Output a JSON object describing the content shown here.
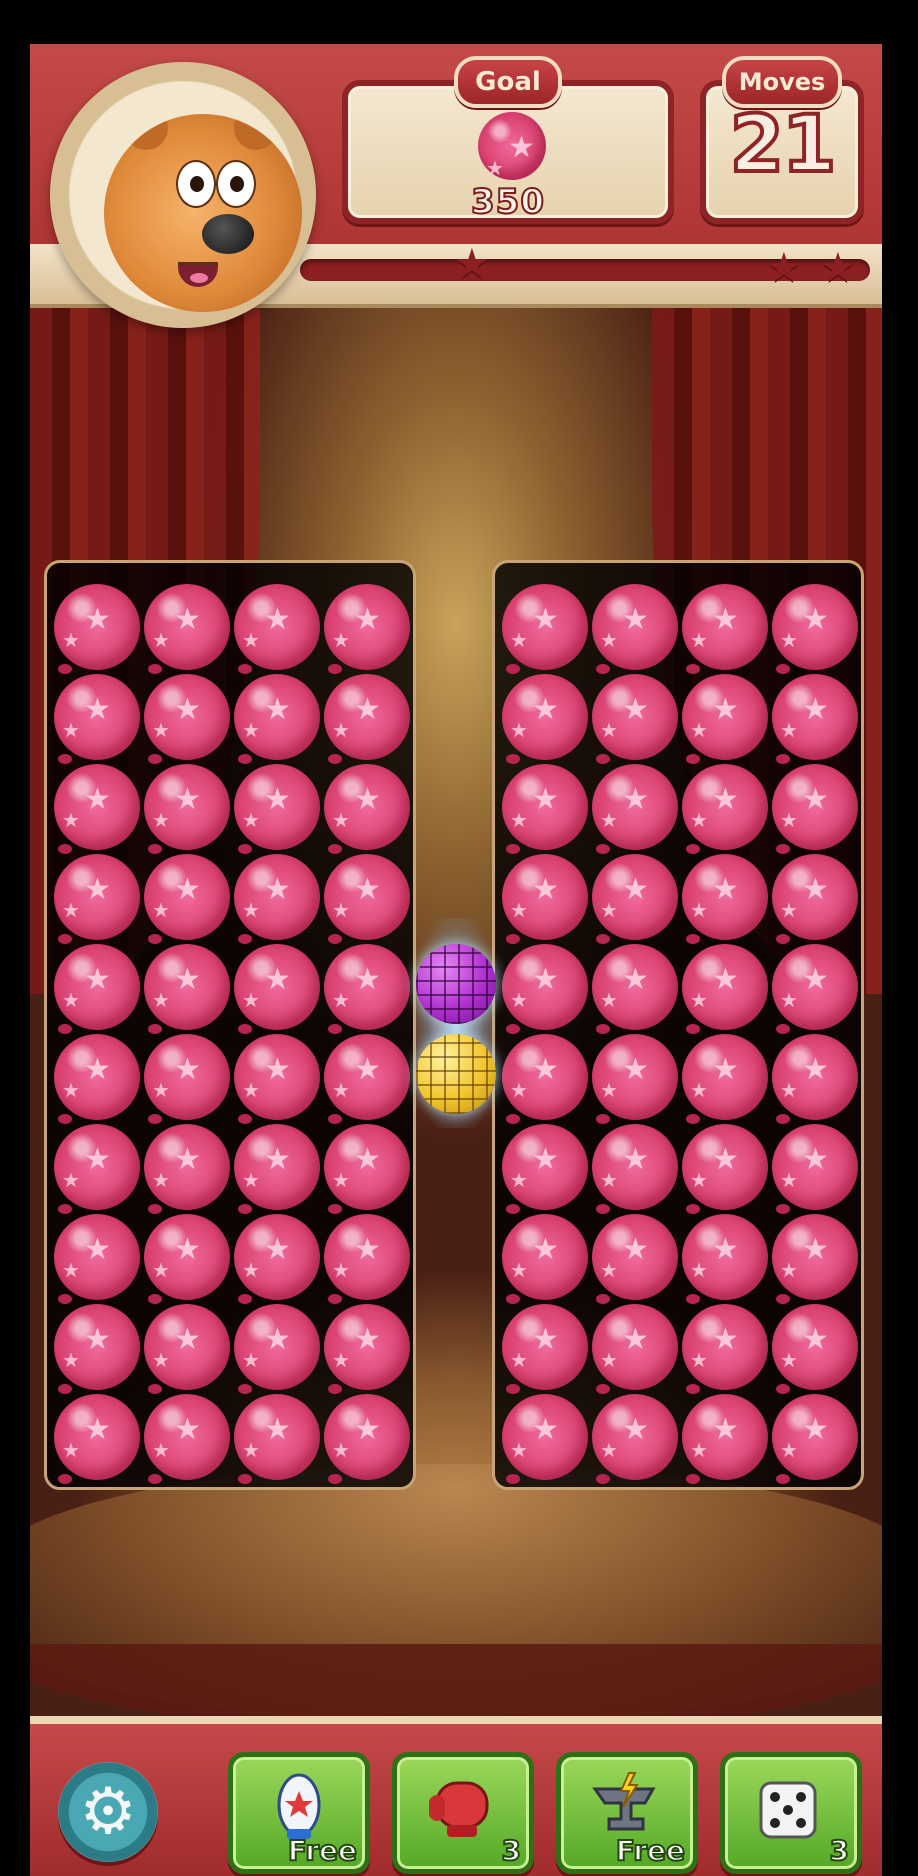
{
  "hud": {
    "goal_label": "Goal",
    "goal_count": "350",
    "goal_item": "pink-star-balloon",
    "moves_label": "Moves",
    "moves_value": "21",
    "progress": 0.0,
    "stars_total": 3
  },
  "board": {
    "left_grid": {
      "rows": 10,
      "cols": 4,
      "item": "pink-star-balloon"
    },
    "right_grid": {
      "rows": 10,
      "cols": 4,
      "item": "pink-star-balloon"
    },
    "center_items": [
      "purple-disco-ball",
      "yellow-disco-ball"
    ]
  },
  "bottom_bar": {
    "settings_icon": "gear-icon",
    "boosters": [
      {
        "icon": "rocket-icon",
        "label": "Free"
      },
      {
        "icon": "boxing-glove-icon",
        "label": "3"
      },
      {
        "icon": "anvil-icon",
        "label": "Free"
      },
      {
        "icon": "dice-icon",
        "label": "3"
      }
    ]
  },
  "colors": {
    "hud_red": "#a8302f",
    "balloon_pink": "#d9406f",
    "booster_green": "#55a827",
    "settings_teal": "#2b7c87"
  }
}
